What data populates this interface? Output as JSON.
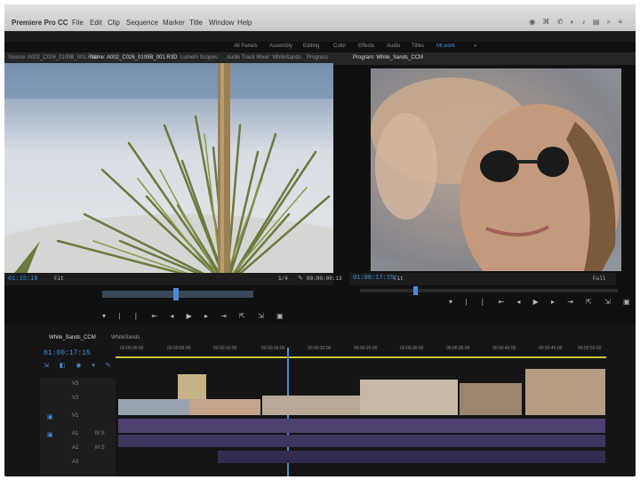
{
  "menubar": {
    "app_name": "Premiere Pro CC",
    "items": [
      "File",
      "Edit",
      "Clip",
      "Sequence",
      "Marker",
      "Title",
      "Window",
      "Help"
    ]
  },
  "workspaces": {
    "items": [
      "All Panels",
      "Assembly",
      "Editing",
      "Color",
      "Effects",
      "Audio",
      "Titles",
      "Mr.work"
    ],
    "active": "Mr.work"
  },
  "panel_tabs": {
    "source_items": [
      "Source: A002_C026_0109B_001.R3D",
      "Name: A002_C026_0109B_001.R3D",
      "Lumetri Scopes",
      "Audio Track Mixer: WhiteSands",
      "Progress"
    ],
    "program_label": "Program: White_Sands_CCM"
  },
  "source_monitor": {
    "timecode": "01:15:18",
    "fit": "Fit",
    "quality": "1/4",
    "duration": "00:00:00:13"
  },
  "program_monitor": {
    "timecode": "01:00:17:15",
    "fit": "Fit",
    "quality": "Full"
  },
  "timeline": {
    "tabs": [
      "White_Sands_CCM",
      "WhiteSands"
    ],
    "timecode": "01:00:17:15",
    "ruler_labels": [
      "00:00:00:00",
      "00:00:05:00",
      "00:00:10:00",
      "00:00:15:00",
      "00:00:20:00",
      "00:00:25:00",
      "00:00:30:00",
      "00:00:35:00",
      "00:00:40:00",
      "00:00:45:00",
      "00:00:50:00"
    ],
    "track_labels": [
      "V3",
      "V2",
      "V1",
      "A1",
      "A2",
      "A3"
    ]
  },
  "colors": {
    "accent": "#3a8fe0",
    "timeline_bar": "#c8c832",
    "audio_clip": "#5a4a78"
  }
}
